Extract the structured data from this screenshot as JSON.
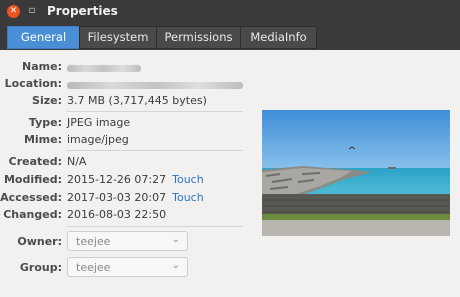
{
  "window": {
    "title": "Properties"
  },
  "tabs": [
    {
      "label": "General"
    },
    {
      "label": "Filesystem"
    },
    {
      "label": "Permissions"
    },
    {
      "label": "MediaInfo"
    }
  ],
  "fields": {
    "name_label": "Name:",
    "location_label": "Location:",
    "size_label": "Size:",
    "size_value": "3.7 MB (3,717,445 bytes)",
    "type_label": "Type:",
    "type_value": "JPEG image",
    "mime_label": "Mime:",
    "mime_value": "image/jpeg",
    "created_label": "Created:",
    "created_value": "N/A",
    "modified_label": "Modified:",
    "modified_value": "2015-12-26 07:27",
    "accessed_label": "Accessed:",
    "accessed_value": "2017-03-03 20:07",
    "changed_label": "Changed:",
    "changed_value": "2016-08-03 22:50",
    "touch_label": "Touch",
    "owner_label": "Owner:",
    "owner_value": "teejee",
    "group_label": "Group:",
    "group_value": "teejee"
  },
  "colors": {
    "accent": "#4a8fd6",
    "titlebar": "#3a3a3a",
    "close": "#e95420",
    "link": "#2a76c6"
  }
}
